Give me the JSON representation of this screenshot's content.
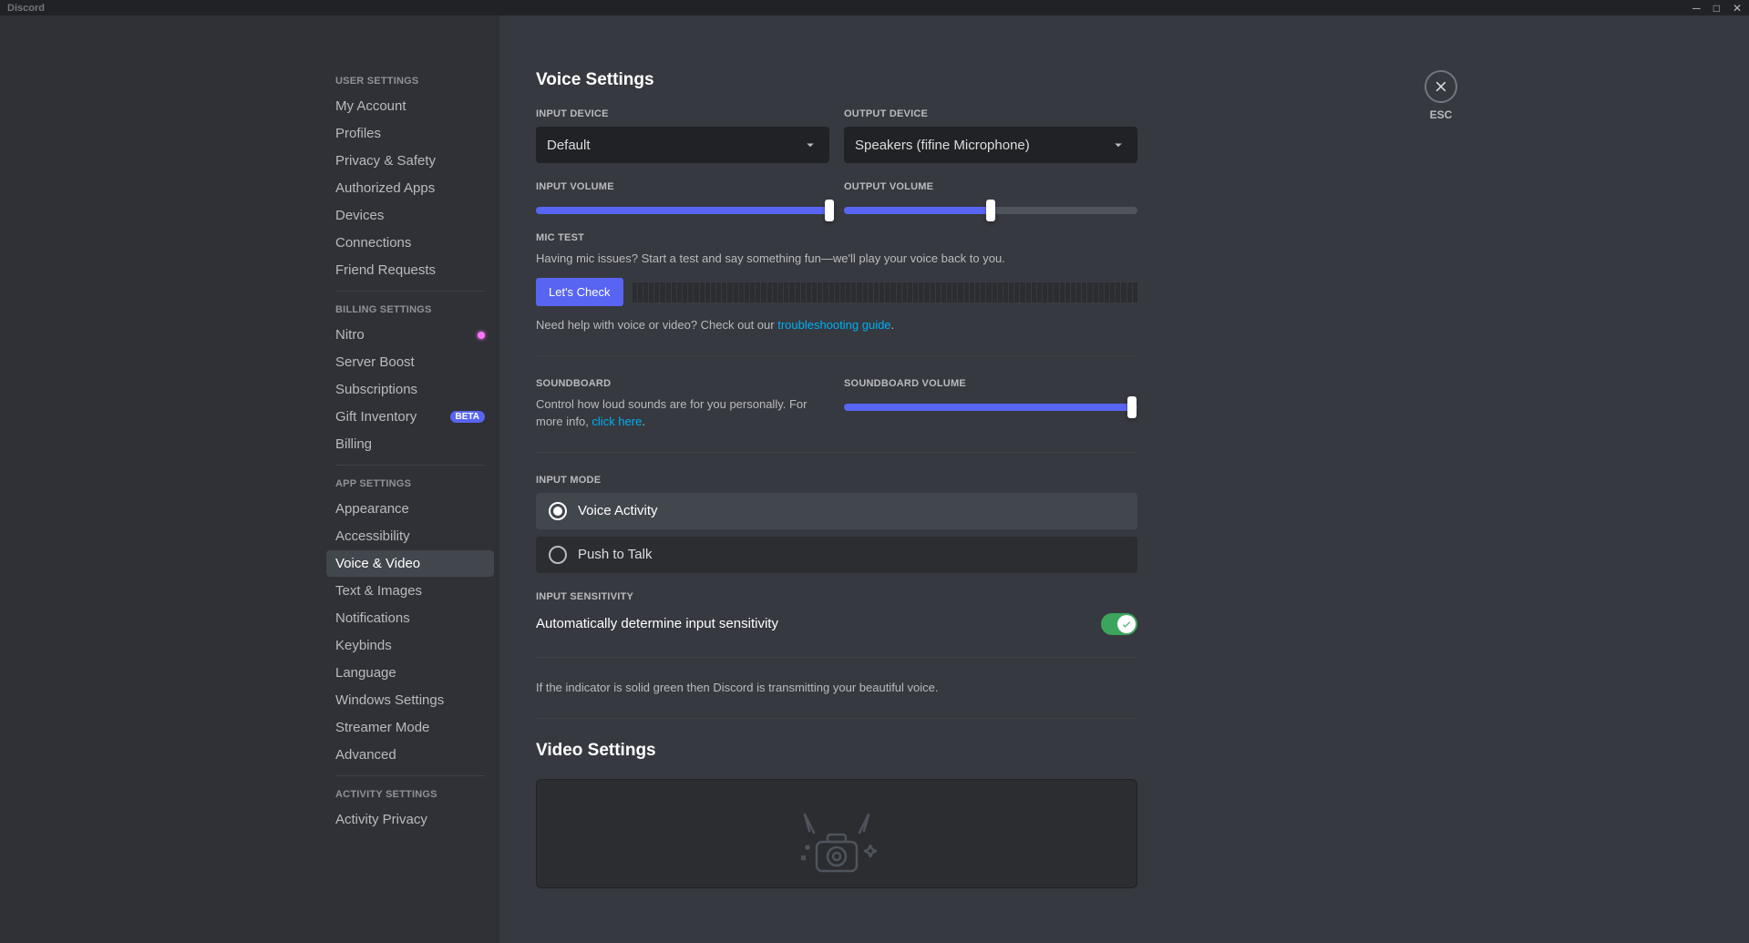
{
  "titlebar": {
    "app": "Discord"
  },
  "close": {
    "esc": "ESC"
  },
  "sidebar": {
    "user_settings": {
      "heading": "User Settings",
      "items": [
        "My Account",
        "Profiles",
        "Privacy & Safety",
        "Authorized Apps",
        "Devices",
        "Connections",
        "Friend Requests"
      ]
    },
    "billing_settings": {
      "heading": "Billing Settings",
      "items": [
        "Nitro",
        "Server Boost",
        "Subscriptions",
        "Gift Inventory",
        "Billing"
      ],
      "gift_badge": "BETA"
    },
    "app_settings": {
      "heading": "App Settings",
      "items": [
        "Appearance",
        "Accessibility",
        "Voice & Video",
        "Text & Images",
        "Notifications",
        "Keybinds",
        "Language",
        "Windows Settings",
        "Streamer Mode",
        "Advanced"
      ]
    },
    "activity_settings": {
      "heading": "Activity Settings",
      "items": [
        "Activity Privacy"
      ]
    }
  },
  "voice": {
    "title": "Voice Settings",
    "input_device_label": "Input Device",
    "input_device_value": "Default",
    "output_device_label": "Output Device",
    "output_device_value": "Speakers (fifine Microphone)",
    "input_volume_label": "Input Volume",
    "input_volume_pct": 100,
    "output_volume_label": "Output Volume",
    "output_volume_pct": 50,
    "mic_test_label": "Mic Test",
    "mic_test_desc": "Having mic issues? Start a test and say something fun—we'll play your voice back to you.",
    "lets_check": "Let's Check",
    "help_prefix": "Need help with voice or video? Check out our ",
    "help_link": "troubleshooting guide",
    "help_suffix": ".",
    "soundboard_label": "Soundboard",
    "soundboard_desc_prefix": "Control how loud sounds are for you personally. For more info, ",
    "soundboard_link": "click here",
    "soundboard_desc_suffix": ".",
    "soundboard_volume_label": "Soundboard Volume",
    "soundboard_volume_pct": 98,
    "input_mode_label": "Input Mode",
    "input_mode_voice": "Voice Activity",
    "input_mode_ptt": "Push to Talk",
    "input_sensitivity_label": "Input Sensitivity",
    "auto_sensitivity": "Automatically determine input sensitivity",
    "indicator_desc": "If the indicator is solid green then Discord is transmitting your beautiful voice."
  },
  "video": {
    "title": "Video Settings"
  }
}
